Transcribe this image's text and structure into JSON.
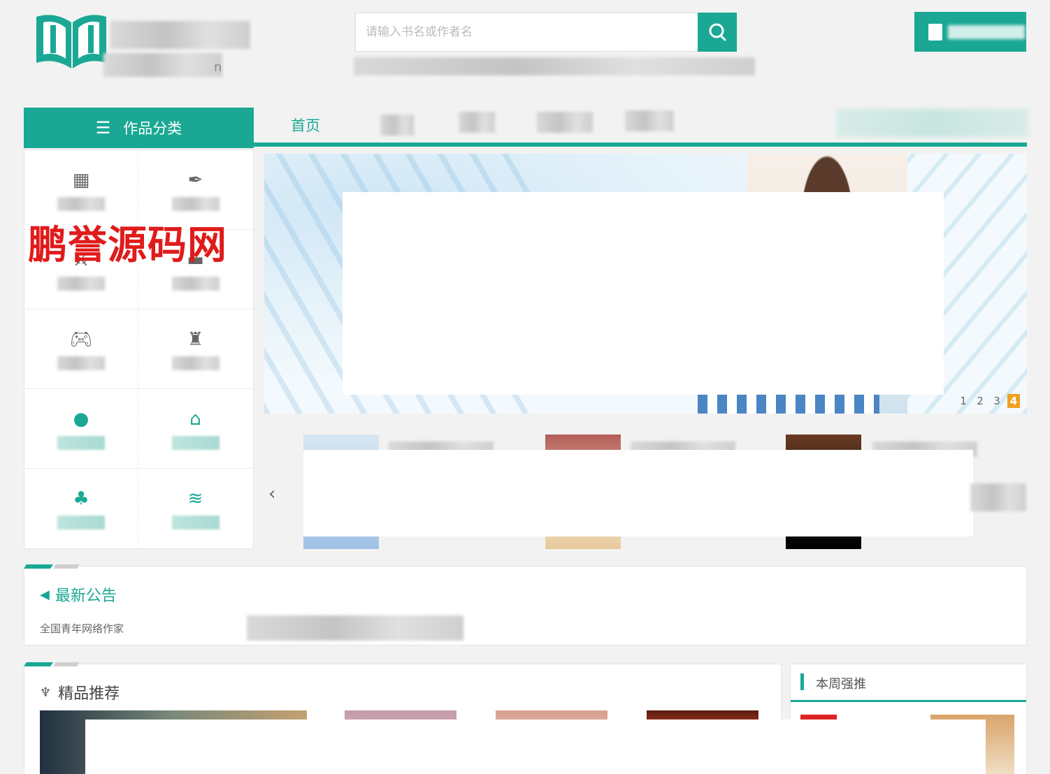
{
  "header": {
    "logo_tail": "n",
    "search_placeholder": "请输入书名或作者名"
  },
  "nav": {
    "category_button": "作品分类",
    "home": "首页"
  },
  "banner": {
    "pages": [
      "1",
      "2",
      "3",
      "4"
    ],
    "active_page": "4"
  },
  "watermark": "鹏誉源码网",
  "notice": {
    "title": "最新公告",
    "text": "全国青年网络作家"
  },
  "recommend": {
    "title": "精品推荐"
  },
  "weekly": {
    "title": "本周强推"
  },
  "colors": {
    "accent": "#1aa894",
    "watermark": "#e01b1b",
    "page_active": "#f0a020"
  },
  "icons": {
    "search": "search-icon",
    "menu": "menu-icon",
    "speaker": "speaker-icon",
    "trophy": "trophy-icon",
    "arrow_left": "chevron-left-icon"
  }
}
